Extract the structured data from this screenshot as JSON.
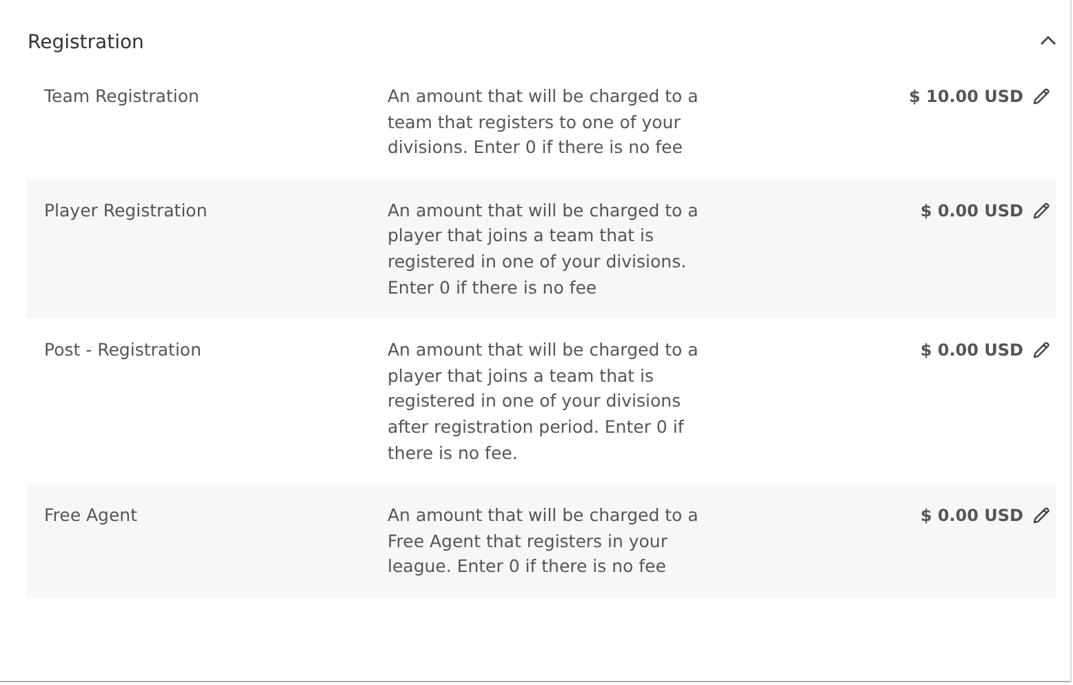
{
  "section": {
    "title": "Registration",
    "expanded": true
  },
  "fees": [
    {
      "name": "Team Registration",
      "description": "An amount that will be charged to a team that registers to one of your divisions. Enter 0 if there is no fee",
      "amount": "$ 10.00 USD"
    },
    {
      "name": "Player Registration",
      "description": "An amount that will be charged to a player that joins a team that is registered in one of your divisions. Enter 0 if there is no fee",
      "amount": "$ 0.00 USD"
    },
    {
      "name": "Post - Registration",
      "description": "An amount that will be charged to a player that joins a team that is registered in one of your divisions after registration period. Enter 0 if there is no fee.",
      "amount": "$ 0.00 USD"
    },
    {
      "name": "Free Agent",
      "description": "An amount that will be charged to a Free Agent that registers in your league. Enter 0 if there is no fee",
      "amount": "$ 0.00 USD"
    }
  ]
}
